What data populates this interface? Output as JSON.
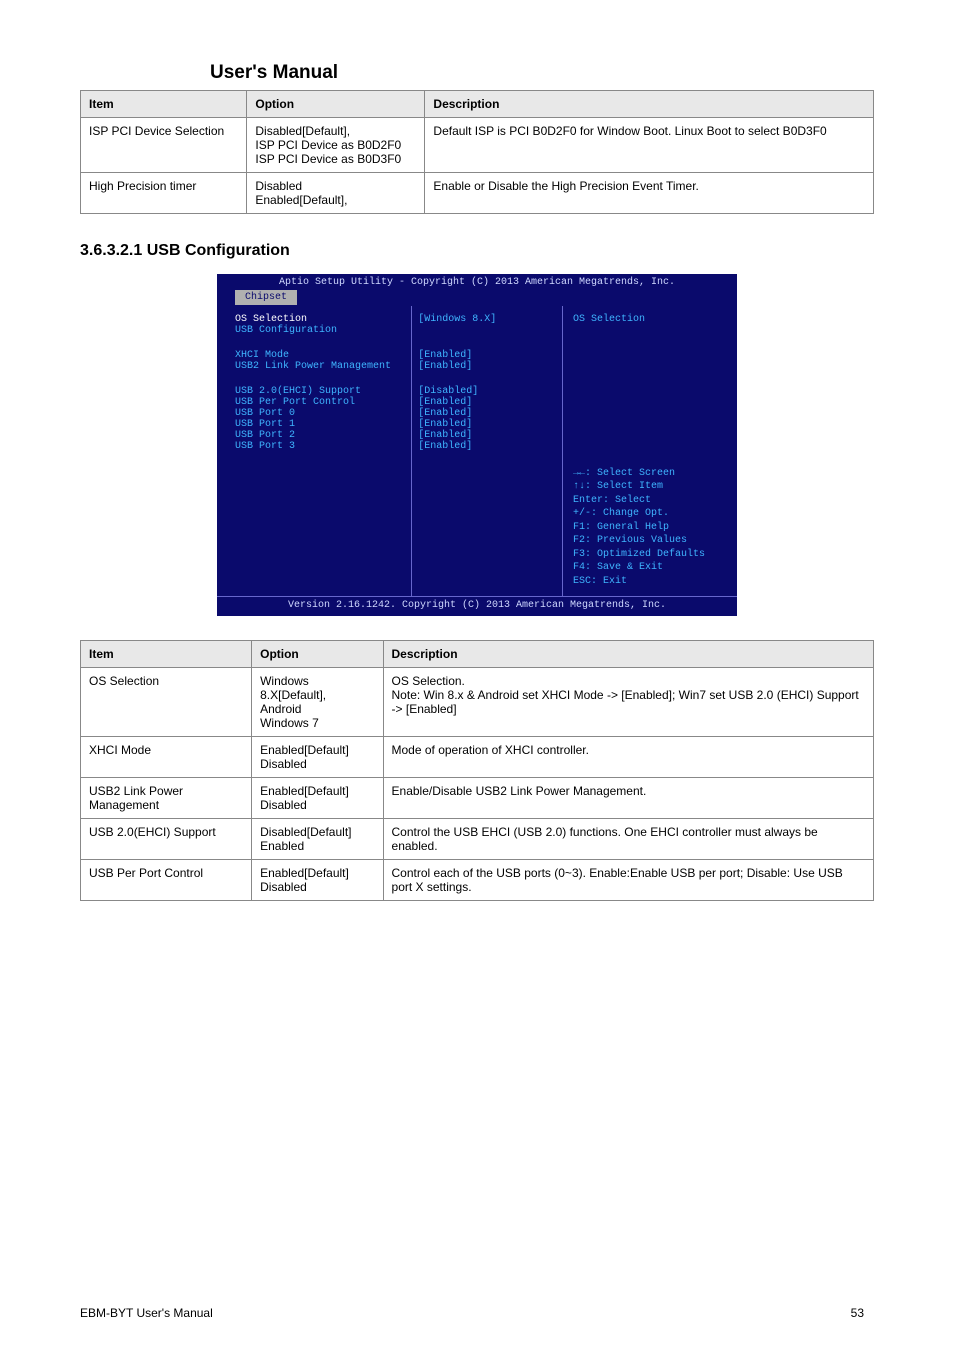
{
  "header": {
    "title": "User's Manual"
  },
  "table1": {
    "headers": [
      "Item",
      "Option",
      "Description"
    ],
    "rows": [
      {
        "item": "ISP PCI Device Selection",
        "options": [
          "Disabled[Default],",
          "ISP PCI Device as B0D2F0",
          "ISP PCI Device as B0D3F0"
        ],
        "desc": "Default ISP is PCI B0D2F0 for Window Boot. Linux Boot to select B0D3F0"
      },
      {
        "item": "High Precision timer",
        "options": [
          "Disabled",
          "Enabled[Default],"
        ],
        "desc": "Enable or Disable the High Precision Event Timer."
      }
    ]
  },
  "section": "3.6.3.2.1  USB Configuration",
  "bios": {
    "top": "Aptio Setup Utility - Copyright (C) 2013 American Megatrends, Inc.",
    "tab": "Chipset",
    "left_rows": [
      {
        "label": "OS Selection",
        "value": "[Windows 8.X]",
        "sel": true
      },
      {
        "label": "USB Configuration",
        "value": ""
      },
      {
        "gap": true
      },
      {
        "label": "XHCI Mode",
        "value": "[Enabled]"
      },
      {
        "label": "USB2 Link Power Management",
        "value": "[Enabled]"
      },
      {
        "gap": true
      },
      {
        "label": "USB 2.0(EHCI) Support",
        "value": "[Disabled]"
      },
      {
        "label": "USB Per Port Control",
        "value": "[Enabled]"
      },
      {
        "label": "USB Port 0",
        "value": "[Enabled]"
      },
      {
        "label": "USB Port 1",
        "value": "[Enabled]"
      },
      {
        "label": "USB Port 2",
        "value": "[Enabled]"
      },
      {
        "label": "USB Port 3",
        "value": "[Enabled]"
      }
    ],
    "help_title": "OS Selection",
    "keys": [
      "→←: Select Screen",
      "↑↓: Select Item",
      "Enter: Select",
      "+/-: Change Opt.",
      "F1: General Help",
      "F2: Previous Values",
      "F3: Optimized Defaults",
      "F4: Save & Exit",
      "ESC: Exit"
    ],
    "footer": "Version 2.16.1242. Copyright (C) 2013 American Megatrends, Inc."
  },
  "table2": {
    "headers": [
      "Item",
      "Option",
      "Description"
    ],
    "rows": [
      {
        "item": "OS Selection",
        "options": [
          "Windows 8.X[Default],",
          "Android",
          "Windows 7"
        ],
        "desc": "OS Selection.\nNote: Win 8.x & Android set XHCI Mode -> [Enabled]; Win7 set USB 2.0 (EHCI) Support -> [Enabled]"
      },
      {
        "item": "XHCI Mode",
        "options": [
          "Enabled[Default]",
          "Disabled"
        ],
        "desc": "Mode of operation of XHCI controller."
      },
      {
        "item": "USB2 Link Power Management",
        "options": [
          "Enabled[Default]",
          "Disabled"
        ],
        "desc": "Enable/Disable USB2 Link Power Management."
      },
      {
        "item": "USB 2.0(EHCI) Support",
        "options": [
          "Disabled[Default]",
          "Enabled"
        ],
        "desc": "Control the USB EHCI (USB 2.0) functions. One EHCI controller must always be enabled."
      },
      {
        "item": "USB Per Port Control",
        "options": [
          "Enabled[Default]",
          "Disabled"
        ],
        "desc": "Control each of the USB ports (0~3). Enable:Enable USB per port; Disable: Use USB port X settings."
      }
    ]
  },
  "footer": {
    "label": "EBM-BYT User's Manual",
    "page": "53"
  }
}
